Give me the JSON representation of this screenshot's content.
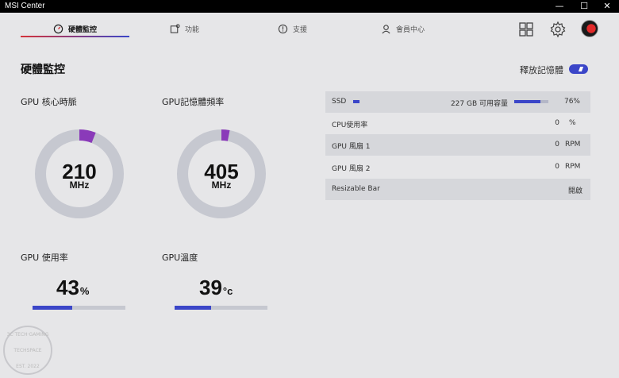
{
  "window": {
    "title": "MSI Center",
    "minimize": "—",
    "maximize": "☐",
    "close": "✕"
  },
  "nav": {
    "tabs": [
      {
        "label": "硬體監控",
        "icon": "gauge-icon",
        "active": true
      },
      {
        "label": "功能",
        "icon": "feature-icon",
        "active": false
      },
      {
        "label": "支援",
        "icon": "support-icon",
        "active": false
      },
      {
        "label": "會員中心",
        "icon": "member-icon",
        "active": false
      }
    ]
  },
  "toolbar": {
    "icons": [
      "grid-icon",
      "gear-icon",
      "avatar"
    ]
  },
  "page": {
    "title": "硬體監控",
    "release_memory_label": "釋放記憶體",
    "release_memory_on": true
  },
  "gauges": [
    {
      "label": "GPU 核心時脈",
      "value": "210",
      "unit": "MHz",
      "level": 0.06
    },
    {
      "label": "GPU記憶體頻率",
      "value": "405",
      "unit": "MHz",
      "level": 0.03
    }
  ],
  "usage": [
    {
      "label": "GPU 使用率",
      "value": "43",
      "unit": "%",
      "level": 0.43
    },
    {
      "label": "GPU溫度",
      "value": "39",
      "unit": "°c",
      "level": 0.39
    }
  ],
  "info_table": {
    "ssd": {
      "name": "SSD",
      "capacity": "227 GB 可用容量",
      "percent": "76%",
      "level": 0.76
    },
    "rows": [
      {
        "name": "CPU使用率",
        "value": "0",
        "unit": "%"
      },
      {
        "name": "GPU 風扇 1",
        "value": "0",
        "unit": "RPM"
      },
      {
        "name": "GPU 風扇 2",
        "value": "0",
        "unit": "RPM"
      },
      {
        "name": "Resizable Bar",
        "value": "開啟",
        "unit": ""
      }
    ]
  },
  "colors": {
    "accent": "#3b46c8",
    "gauge_arc": "#8a3ab9",
    "gauge_track": "#c6c8d0",
    "tab_gradient_start": "#d4333a"
  },
  "watermark": {
    "top_text": "3C·TECH·GAMING",
    "name": "TECHSPACE",
    "bottom_text": "EST. 2022"
  }
}
